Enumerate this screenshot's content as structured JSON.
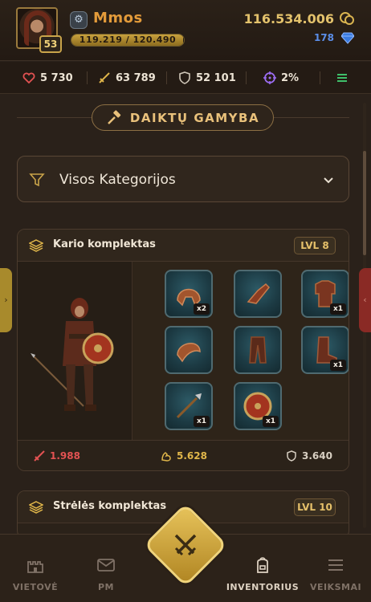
{
  "player": {
    "name": "Mmos",
    "level": "53",
    "xp_text": "119.219 / 120.490",
    "xp_fraction": 0.9895,
    "gold": "116.534.006",
    "gems": "178"
  },
  "stats": {
    "health": "5 730",
    "attack": "63 789",
    "defense": "52 101",
    "crit": "2%"
  },
  "crafting": {
    "button_label": "DAIKTŲ GAMYBA"
  },
  "filter": {
    "selected": "Visos Kategorijos"
  },
  "sets": [
    {
      "title": "Kario komplektas",
      "level": "LVL 8",
      "items": [
        {
          "icon": "helmet-icon",
          "qty": "x2"
        },
        {
          "icon": "gauntlet-icon",
          "qty": ""
        },
        {
          "icon": "armor-icon",
          "qty": "x1"
        },
        {
          "icon": "pauldron-icon",
          "qty": ""
        },
        {
          "icon": "pants-icon",
          "qty": ""
        },
        {
          "icon": "boot-icon",
          "qty": "x1"
        },
        {
          "icon": "spear-icon",
          "qty": "x1"
        },
        {
          "icon": "shield-icon",
          "qty": "x1"
        }
      ],
      "footer": {
        "attack": "1.988",
        "strength": "5.628",
        "defense": "3.640"
      }
    },
    {
      "title": "Strėlės komplektas",
      "level": "LVL 10"
    }
  ],
  "nav": {
    "items": [
      {
        "label": "VIETOVĖ",
        "icon": "castle-icon"
      },
      {
        "label": "PM",
        "icon": "mail-icon"
      },
      {
        "label": "INVENTORIUS",
        "icon": "backpack-icon"
      },
      {
        "label": "VEIKSMAI",
        "icon": "menu-icon"
      }
    ],
    "center_icon": "crossed-swords-icon"
  },
  "colors": {
    "accent_gold": "#e3c26c",
    "name_orange": "#e39b3a",
    "attack_red": "#e25252",
    "gem_blue": "#5b8ee8"
  }
}
